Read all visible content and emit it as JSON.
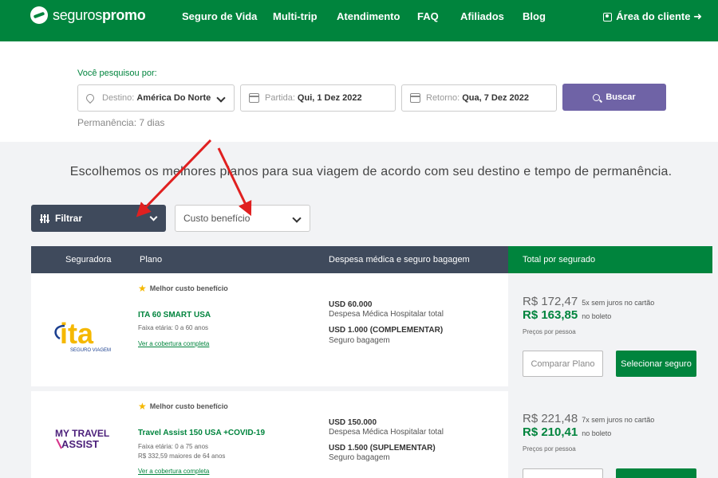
{
  "header": {
    "logo": {
      "part1": "seguros",
      "part2": "promo"
    },
    "nav": [
      "Seguro de Vida",
      "Multi-trip",
      "Atendimento",
      "FAQ",
      "Afiliados",
      "Blog"
    ],
    "client_area": "Área do cliente ➜"
  },
  "search": {
    "label": "Você pesquisou por:",
    "destination": {
      "label": "Destino:",
      "value": "América Do Norte"
    },
    "departure": {
      "label": "Partida:",
      "value": "Qui, 1 Dez 2022"
    },
    "return": {
      "label": "Retorno:",
      "value": "Qua, 7 Dez 2022"
    },
    "button": "Buscar",
    "stay": "Permanência: 7 dias"
  },
  "intro": "Escolhemos os melhores planos para sua viagem de acordo com seu destino e tempo de permanência.",
  "filters": {
    "filter_button": "Filtrar",
    "sort_value": "Custo benefício"
  },
  "table": {
    "headers": {
      "insurer": "Seguradora",
      "plan": "Plano",
      "coverage": "Despesa médica e seguro bagagem",
      "total": "Total por segurado"
    },
    "rows": [
      {
        "insurer_logo": "ita-seguro-viagem-logo",
        "logo_text": "ita",
        "logo_subtext": "SEGURO VIAGEM",
        "badge": "Melhor custo benefício",
        "plan": "ITA 60 SMART USA",
        "meta1": "Faixa etária: 0 a 60 anos",
        "meta2": "",
        "link": "Ver a cobertura completa",
        "medical_value": "USD 60.000",
        "medical_label": "Despesa Médica Hospitalar total",
        "baggage_value": "USD 1.000 (COMPLEMENTAR)",
        "baggage_label": "Seguro bagagem",
        "price_card": "R$ 172,47",
        "price_card_note": "5x sem juros no cartão",
        "price_boleto": "R$ 163,85",
        "price_boleto_note": "no boleto",
        "price_per": "Preços por pessoa",
        "compare": "Comparar Plano",
        "select": "Selecionar seguro"
      },
      {
        "insurer_logo": "my-travel-assist-logo",
        "logo_text1": "MY TRAVEL",
        "logo_text2": "ASSIST",
        "badge": "Melhor custo benefício",
        "plan": "Travel Assist 150 USA +COVID-19",
        "meta1": "Faixa etária: 0 a 75 anos",
        "meta2": "R$ 332,59 maiores de 64 anos",
        "link": "Ver a cobertura completa",
        "medical_value": "USD 150.000",
        "medical_label": "Despesa Médica Hospitalar total",
        "baggage_value": "USD 1.500 (SUPLEMENTAR)",
        "baggage_label": "Seguro bagagem",
        "price_card": "R$ 221,48",
        "price_card_note": "7x sem juros no cartão",
        "price_boleto": "R$ 210,41",
        "price_boleto_note": "no boleto",
        "price_per": "Preços por pessoa",
        "compare": "",
        "select": ""
      }
    ]
  },
  "colors": {
    "brand_green": "#00843d",
    "header_dark": "#3f4a5c",
    "search_button": "#6f63a6",
    "annotation_arrow": "#e02020"
  }
}
